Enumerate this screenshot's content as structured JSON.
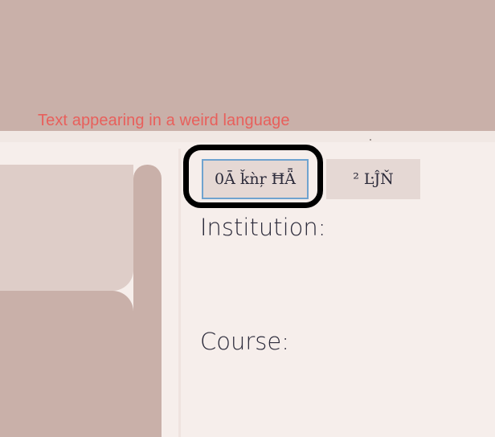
{
  "annotation": {
    "text": "Text appearing in a weird language"
  },
  "tabs": [
    {
      "label": "0Ā ǩǹŗ ĦǞ",
      "selected": true
    },
    {
      "label": "² ĿĴŇ",
      "selected": false
    }
  ],
  "form": {
    "institution_label": "Institution:",
    "course_label": "Course:"
  },
  "colors": {
    "background": "#f6eeeb",
    "band": "#c9b0a9",
    "annotation": "#e85f5b",
    "tab_bg": "#e5d8d4",
    "focus_border": "#6fa3cf",
    "highlight_circle": "#000000"
  }
}
